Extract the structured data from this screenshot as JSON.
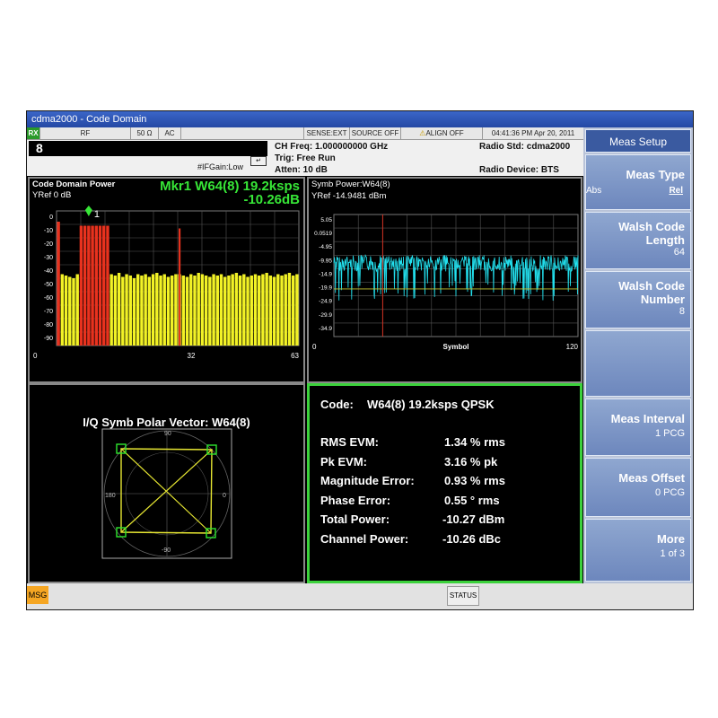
{
  "window": {
    "title": "cdma2000 - Code Domain"
  },
  "statusbar": {
    "rx": "RX",
    "rf": "RF",
    "impedance": "50 Ω",
    "coupling": "AC",
    "sense": "SENSE:EXT",
    "source": "SOURCE OFF",
    "align": "ALIGN OFF",
    "datetime": "04:41:36 PM Apr 20, 2011"
  },
  "info": {
    "entry": "8",
    "ifgain": "#IFGain:Low",
    "ch_freq": "CH Freq: 1.000000000 GHz",
    "trig": "Trig: Free Run",
    "atten": "Atten: 10 dB",
    "radio_std": "Radio Std: cdma2000",
    "radio_device": "Radio Device: BTS"
  },
  "softkeys": {
    "header": "Meas Setup",
    "meas_type": {
      "label": "Meas Type",
      "opt_abs": "Abs",
      "opt_rel": "Rel"
    },
    "walsh_len": {
      "label1": "Walsh Code",
      "label2": "Length",
      "value": "64"
    },
    "walsh_num": {
      "label1": "Walsh Code",
      "label2": "Number",
      "value": "8"
    },
    "meas_interval": {
      "label": "Meas Interval",
      "value": "1 PCG"
    },
    "meas_offset": {
      "label": "Meas Offset",
      "value": "0 PCG"
    },
    "more": {
      "label": "More",
      "value": "1 of 3"
    }
  },
  "cdp": {
    "title": "Code Domain Power",
    "yref": "YRef  0 dB",
    "marker1": "Mkr1 W64(8) 19.2ksps",
    "marker2": "-10.26dB",
    "marker_label": "1",
    "x_left": "0",
    "x_mid": "32",
    "x_right": "63"
  },
  "symb": {
    "title": "Symb Power:W64(8)",
    "yref": "YRef  -14.9481 dBm",
    "xlabel": "Symbol",
    "x_left": "0",
    "x_right": "120"
  },
  "iq": {
    "title": "I/Q Symb Polar Vector: W64(8)",
    "top": "90",
    "left": "180",
    "right": "0",
    "bottom": "-90"
  },
  "results": {
    "code_label": "Code:",
    "code_value": "W64(8) 19.2ksps QPSK",
    "rows": [
      {
        "label": "RMS EVM:",
        "value": "1.34 % rms"
      },
      {
        "label": "Pk EVM:",
        "value": "3.16 % pk"
      },
      {
        "label": "Magnitude Error:",
        "value": "0.93 % rms"
      },
      {
        "label": "Phase Error:",
        "value": "0.55 ° rms"
      },
      {
        "label": "Total Power:",
        "value": "-10.27 dBm"
      },
      {
        "label": "Channel Power:",
        "value": "-10.26 dBc"
      }
    ]
  },
  "bottom": {
    "msg": "MSG",
    "status": "STATUS"
  },
  "chart_data": [
    {
      "type": "bar",
      "title": "Code Domain Power",
      "ylim": [
        -100,
        0
      ],
      "y_ticks": [
        "0",
        "-10",
        "-20",
        "-30",
        "-40",
        "-50",
        "-60",
        "-70",
        "-80",
        "-90"
      ],
      "x_ticks": [
        "0",
        "32",
        "63"
      ],
      "values": [
        -8,
        -47,
        -48,
        -49,
        -50,
        -47,
        -11,
        -11,
        -11,
        -11,
        -11,
        -11,
        -11,
        -11,
        -47,
        -48,
        -46,
        -49,
        -47,
        -48,
        -50,
        -47,
        -48,
        -47,
        -49,
        -47,
        -46,
        -48,
        -47,
        -49,
        -48,
        -47,
        -47,
        -48,
        -49,
        -47,
        -48,
        -46,
        -47,
        -48,
        -49,
        -47,
        -48,
        -47,
        -49,
        -48,
        -47,
        -46,
        -48,
        -47,
        -49,
        -48,
        -47,
        -48,
        -47,
        -46,
        -48,
        -49,
        -47,
        -48,
        -47,
        -46,
        -48,
        -47
      ],
      "highlight": [
        0,
        6,
        7,
        8,
        9,
        10,
        11,
        12,
        13
      ],
      "active_extra": [
        {
          "index": 32,
          "value": -13
        }
      ],
      "colors": {
        "active": "#e8321e",
        "noise": "#f2f226"
      }
    },
    {
      "type": "line",
      "title": "Symb Power:W64(8)",
      "xlabel": "Symbol",
      "y_ticks": [
        "5.05",
        "0.0519",
        "-4.95",
        "-9.95",
        "-14.9",
        "-19.9",
        "-24.9",
        "-29.9",
        "-34.9"
      ],
      "xlim": [
        0,
        120
      ],
      "marker_x": 24,
      "colors": {
        "trace": "#22e0ee",
        "ref": "#c8c832",
        "marker": "#d03020"
      }
    }
  ]
}
